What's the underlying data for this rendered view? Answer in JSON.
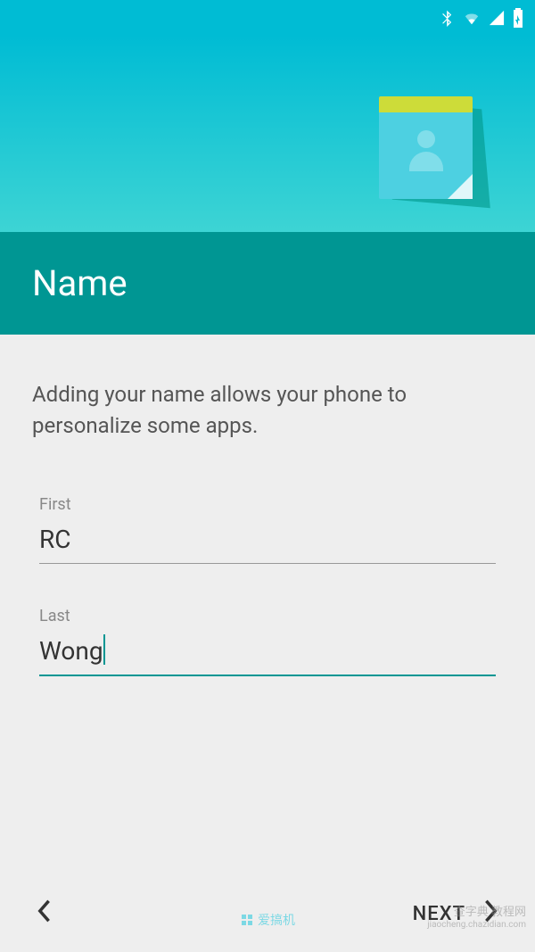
{
  "header": {
    "title": "Name"
  },
  "content": {
    "description": "Adding your name allows your phone to personalize some apps."
  },
  "form": {
    "first": {
      "label": "First",
      "value": "RC"
    },
    "last": {
      "label": "Last",
      "value": "Wong"
    }
  },
  "footer": {
    "next_label": "NEXT"
  },
  "watermarks": {
    "w1": "爱搞机",
    "w2": "查字典 教程网",
    "w3": "jiaocheng.chazidian.com"
  }
}
